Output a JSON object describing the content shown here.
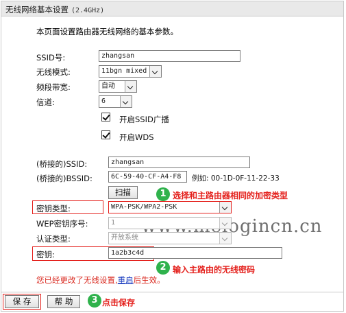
{
  "title": {
    "text": "无线网络基本设置",
    "band": "(2.4GHz)"
  },
  "description": "本页面设置路由器无线网络的基本参数。",
  "ssid": {
    "label": "SSID号:",
    "value": "zhangsan"
  },
  "mode": {
    "label": "无线模式:",
    "value": "11bgn mixed"
  },
  "bandwidth": {
    "label": "频段带宽:",
    "value": "自动"
  },
  "channel": {
    "label": "信道:",
    "value": "6"
  },
  "ssid_broadcast": {
    "label": "开启SSID广播",
    "checked": true
  },
  "wds": {
    "label": "开启WDS",
    "checked": true
  },
  "bridge_ssid": {
    "label": "(桥接的)SSID:",
    "value": "zhangsan"
  },
  "bridge_bssid": {
    "label": "(桥接的)BSSID:",
    "value": "6C-59-40-CF-A4-F8",
    "example": "例如: 00-1D-0F-11-22-33"
  },
  "scan_button": "扫描",
  "key_type": {
    "label": "密钥类型:",
    "value": "WPA-PSK/WPA2-PSK"
  },
  "wep_index": {
    "label": "WEP密钥序号:",
    "value": "1"
  },
  "auth_type": {
    "label": "认证类型:",
    "value": "开放系统"
  },
  "key": {
    "label": "密钥:",
    "value": "1a2b3c4d"
  },
  "annotations": [
    {
      "number": "1",
      "text": "选择和主路由器相同的加密类型"
    },
    {
      "number": "2",
      "text": "输入主路由的无线密码"
    },
    {
      "number": "3",
      "text": "点击保存"
    }
  ],
  "warning": {
    "before": "您已经更改了无线设置,",
    "link": "重启",
    "after": "后生效。"
  },
  "watermark": "www.melogincn.cn",
  "buttons": {
    "save": "保 存",
    "help": "帮 助"
  },
  "colors": {
    "annotation_red": "#e4201c",
    "badge_green": "#2fb24c",
    "link_blue": "#1d3fc0"
  }
}
